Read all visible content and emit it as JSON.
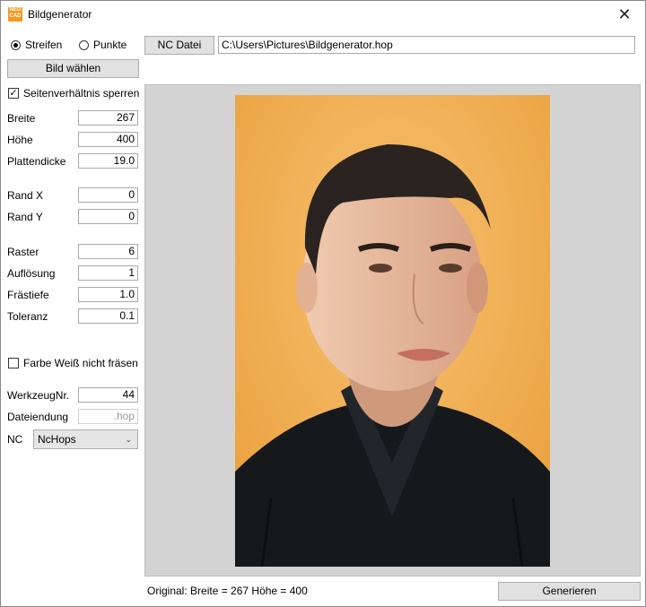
{
  "window": {
    "title": "Bildgenerator",
    "icon": "nc-app-icon",
    "close": "✕"
  },
  "mode": {
    "option1": "Streifen",
    "option2": "Punkte",
    "selected": "Streifen"
  },
  "buttons": {
    "choose_image": "Bild wählen",
    "nc_file": "NC Datei",
    "generate": "Generieren"
  },
  "nc_path": "C:\\Users\\Pictures\\Bildgenerator.hop",
  "lock_aspect": {
    "label": "Seitenverhältnis sperren",
    "checked": true
  },
  "fields": {
    "breite": {
      "label": "Breite",
      "value": "267"
    },
    "hoehe": {
      "label": "Höhe",
      "value": "400"
    },
    "plattendicke": {
      "label": "Plattendicke",
      "value": "19.0"
    },
    "rand_x": {
      "label": "Rand X",
      "value": "0"
    },
    "rand_y": {
      "label": "Rand Y",
      "value": "0"
    },
    "raster": {
      "label": "Raster",
      "value": "6"
    },
    "aufloesung": {
      "label": "Auflösung",
      "value": "1"
    },
    "fraestiefe": {
      "label": "Frästiefe",
      "value": "1.0"
    },
    "toleranz": {
      "label": "Toleranz",
      "value": "0.1"
    },
    "werkzeug": {
      "label": "WerkzeugNr.",
      "value": "44"
    },
    "dateiendung": {
      "label": "Dateiendung",
      "value": ".hop"
    }
  },
  "white_skip": {
    "label": "Farbe Weiß nicht fräsen",
    "checked": false
  },
  "nc": {
    "label": "NC",
    "selected": "NcHops"
  },
  "status_text": "Original: Breite = 267  Höhe = 400",
  "colors": {
    "photo_bg": "#f0a848",
    "preview_bg": "#d3d3d3",
    "button_bg": "#e1e1e1"
  }
}
